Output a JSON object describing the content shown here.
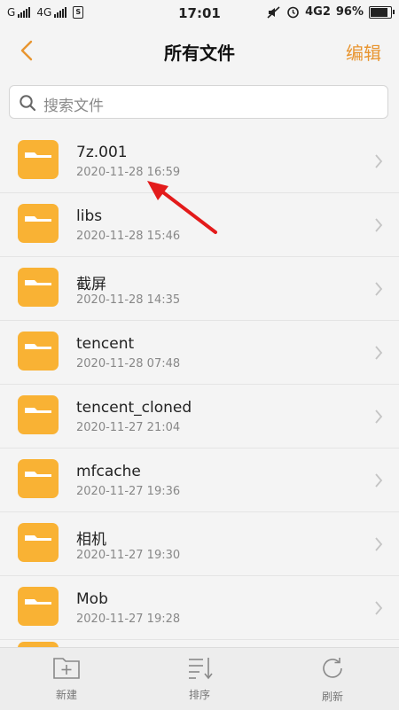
{
  "status_bar": {
    "carrier1": "G",
    "carrier2": "4G",
    "time": "17:01",
    "network": "4G2",
    "battery": "96%",
    "battery_level": 0.96
  },
  "header": {
    "title": "所有文件",
    "edit_label": "编辑",
    "accent_color": "#e89530"
  },
  "search": {
    "placeholder": "搜索文件"
  },
  "files": [
    {
      "name": "7z.001",
      "date": "2020-11-28 16:59"
    },
    {
      "name": "libs",
      "date": "2020-11-28 15:46"
    },
    {
      "name": "截屏",
      "date": "2020-11-28 14:35"
    },
    {
      "name": "tencent",
      "date": "2020-11-28 07:48"
    },
    {
      "name": "tencent_cloned",
      "date": "2020-11-27 21:04"
    },
    {
      "name": "mfcache",
      "date": "2020-11-27 19:36"
    },
    {
      "name": "相机",
      "date": "2020-11-27 19:30"
    },
    {
      "name": "Mob",
      "date": "2020-11-27 19:28"
    }
  ],
  "folder_color": "#f9b234",
  "bottom_bar": {
    "new_label": "新建",
    "sort_label": "排序",
    "refresh_label": "刷新"
  }
}
